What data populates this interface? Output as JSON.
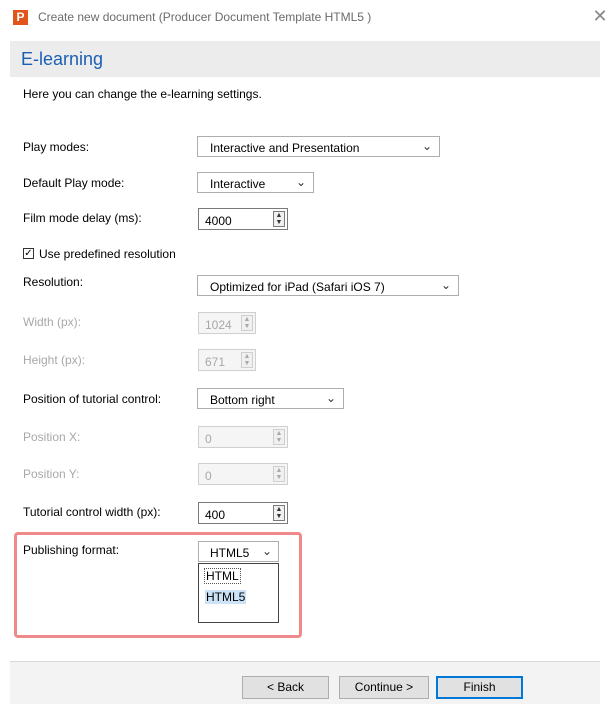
{
  "window": {
    "title": "Create new document (Producer Document Template HTML5 )",
    "app_icon": "P"
  },
  "header": {
    "title": "E-learning"
  },
  "intro": "Here you can change the e-learning settings.",
  "fields": {
    "play_modes": {
      "label": "Play modes:",
      "value": "Interactive and Presentation"
    },
    "default_play_mode": {
      "label": "Default Play mode:",
      "value": "Interactive"
    },
    "film_mode_delay": {
      "label": "Film mode delay (ms):",
      "value": "4000"
    },
    "use_predefined_resolution": {
      "label": "Use predefined resolution",
      "checked": true
    },
    "resolution": {
      "label": "Resolution:",
      "value": "Optimized for iPad (Safari iOS 7)"
    },
    "width": {
      "label": "Width (px):",
      "value": "1024",
      "disabled": true
    },
    "height": {
      "label": "Height (px):",
      "value": "671",
      "disabled": true
    },
    "tutorial_position": {
      "label": "Position of tutorial control:",
      "value": "Bottom right"
    },
    "position_x": {
      "label": "Position X:",
      "value": "0",
      "disabled": true
    },
    "position_y": {
      "label": "Position Y:",
      "value": "0",
      "disabled": true
    },
    "tutorial_width": {
      "label": "Tutorial control width (px):",
      "value": "400"
    },
    "publishing_format": {
      "label": "Publishing format:",
      "value": "HTML5",
      "options": [
        "HTML",
        "HTML5"
      ],
      "highlighted_option": "HTML5"
    }
  },
  "buttons": {
    "back": "< Back",
    "continue": "Continue >",
    "finish": "Finish"
  },
  "colors": {
    "accent": "#1a5fb4",
    "app_icon": "#e1541b",
    "highlight_border": "#f08a8a",
    "selected_option": "#cce3f7"
  }
}
